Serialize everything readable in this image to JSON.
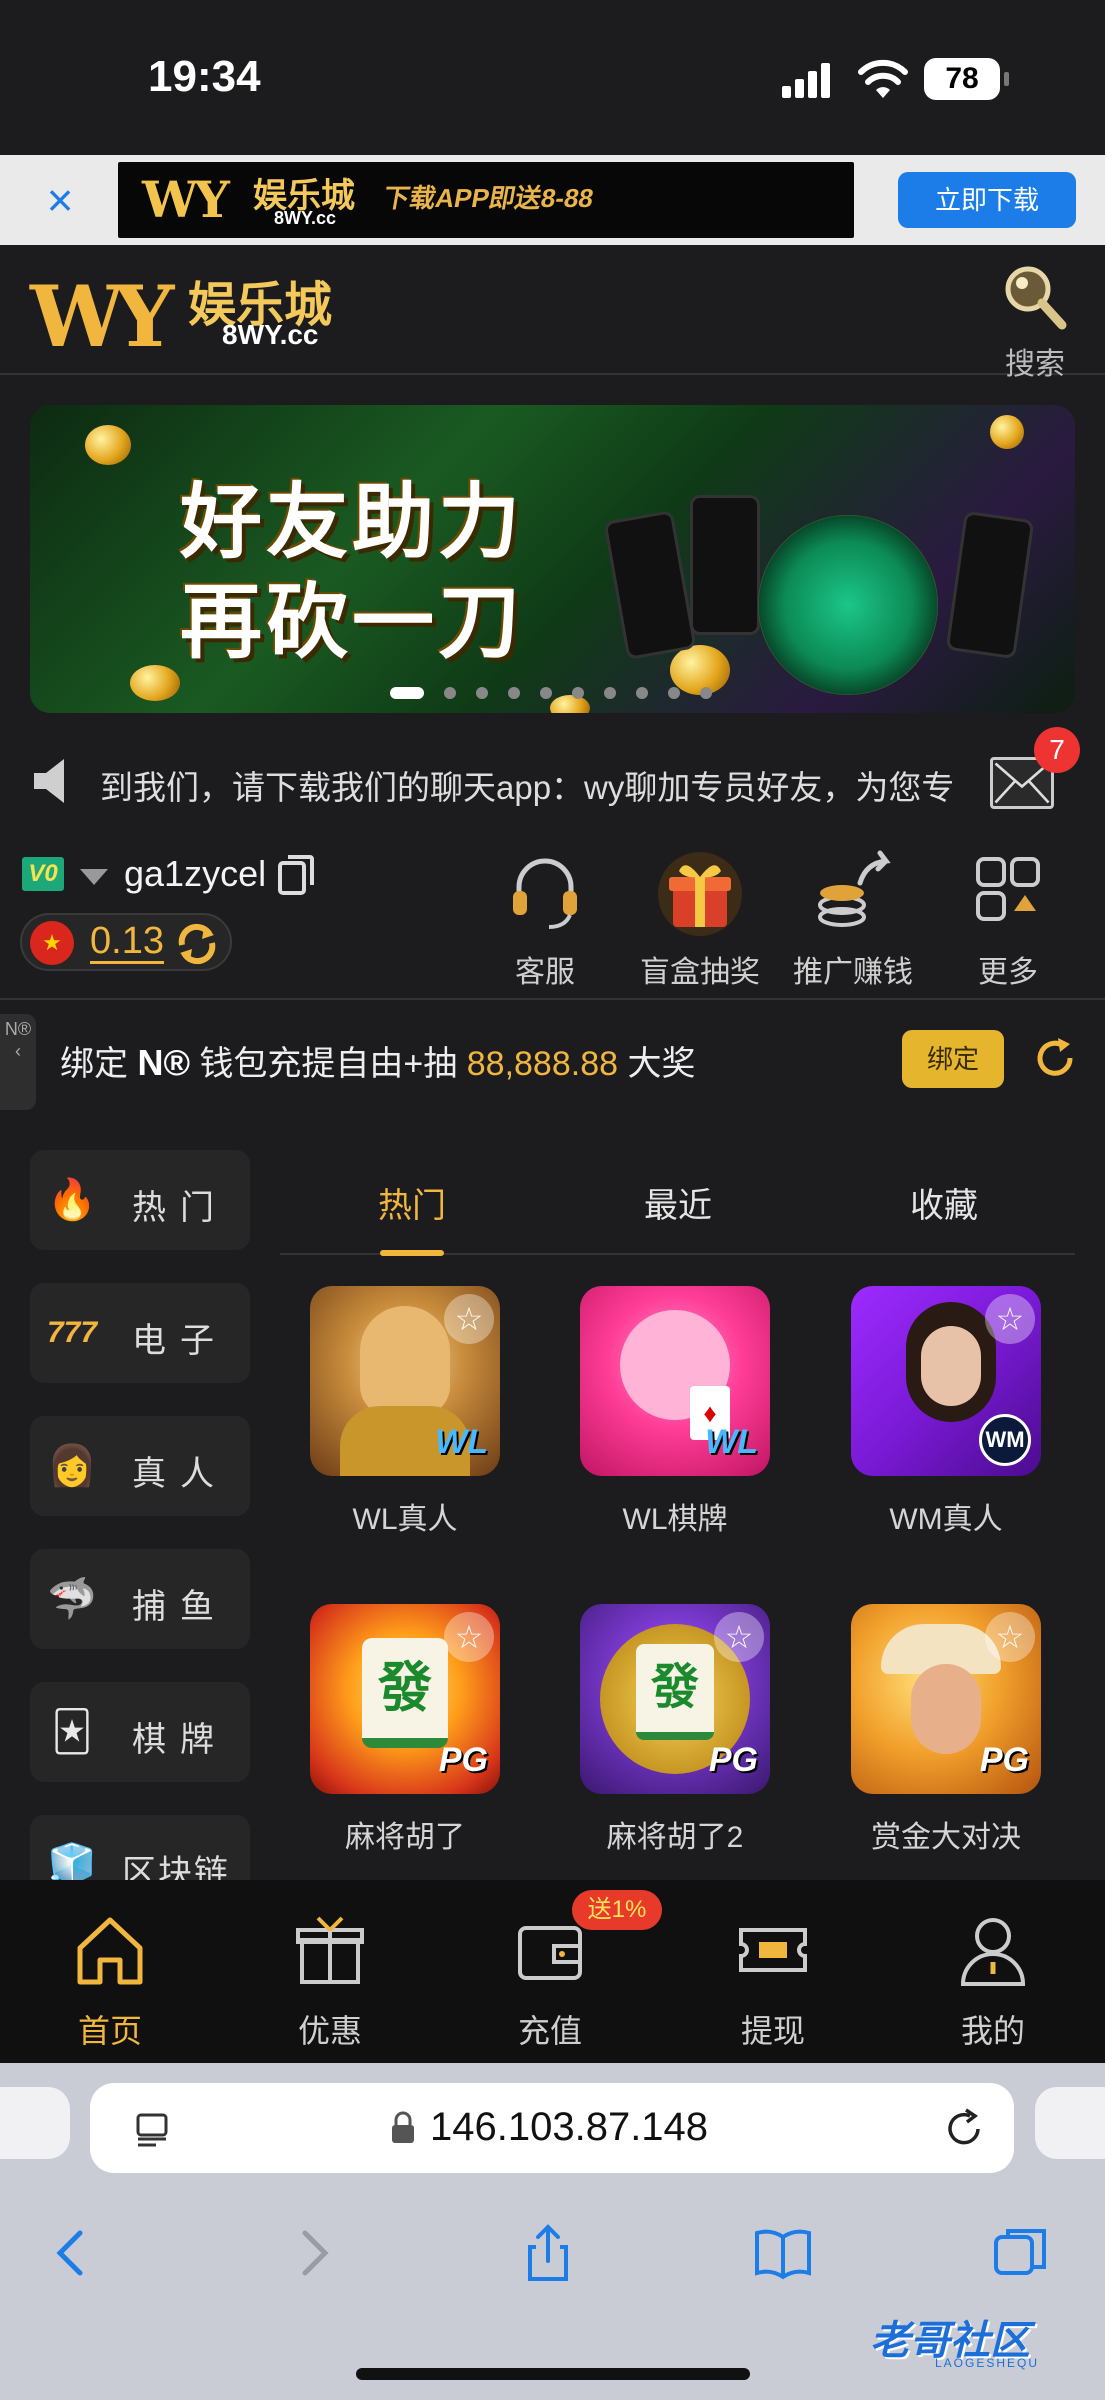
{
  "status_bar": {
    "time": "19:34",
    "battery": "78"
  },
  "download_bar": {
    "close_label": "×",
    "ad": {
      "brand_mark": "WY",
      "brand_name": "娱乐城",
      "domain": "8WY.cc",
      "promo_text": "下载APP即送8-88"
    },
    "download_button": "立即下载"
  },
  "header": {
    "brand_mark": "WY",
    "brand_name": "娱乐城",
    "domain": "8WY.cc",
    "search_label": "搜索",
    "search_icon": "search-icon"
  },
  "banner": {
    "line1": "好友助力",
    "line2": "再砍一刀",
    "slide_count": 10,
    "active_slide": 0
  },
  "marquee": {
    "text": "到我们，请下载我们的聊天app：wy聊加专员好友，为您专",
    "unread_count": "7"
  },
  "user": {
    "vip_level": "V0",
    "username": "ga1zycel",
    "balance": "0.13",
    "currency_flag": "★"
  },
  "quick_actions": [
    {
      "label": "客服",
      "icon": "headset-icon"
    },
    {
      "label": "盲盒抽奖",
      "icon": "gift-box-icon"
    },
    {
      "label": "推广赚钱",
      "icon": "coins-share-icon"
    },
    {
      "label": "更多",
      "icon": "grid-more-icon"
    }
  ],
  "bind_wallet": {
    "side_tab": "N®",
    "prefix": "绑定",
    "brand": "N®",
    "middle": "钱包充提自由+抽",
    "amount": "88,888.88",
    "suffix": "大奖",
    "button": "绑定"
  },
  "categories": [
    {
      "label": "热门",
      "icon": "🔥"
    },
    {
      "label": "电子",
      "icon": "777"
    },
    {
      "label": "真人",
      "icon": "👩"
    },
    {
      "label": "捕鱼",
      "icon": "🦈"
    },
    {
      "label": "棋牌",
      "icon": "🃏"
    },
    {
      "label": "区块链",
      "icon": "🧊"
    }
  ],
  "tabs": [
    {
      "label": "热门",
      "active": true
    },
    {
      "label": "最近",
      "active": false
    },
    {
      "label": "收藏",
      "active": false
    }
  ],
  "games": [
    {
      "label": "WL真人",
      "logo": "WL"
    },
    {
      "label": "WL棋牌",
      "logo": "WL"
    },
    {
      "label": "WM真人",
      "logo": "WM"
    },
    {
      "label": "麻将胡了",
      "logo": "PG",
      "tile": "發"
    },
    {
      "label": "麻将胡了2",
      "logo": "PG",
      "tile": "發"
    },
    {
      "label": "赏金大对决",
      "logo": "PG"
    }
  ],
  "bottom_nav": [
    {
      "label": "首页",
      "active": true
    },
    {
      "label": "优惠",
      "active": false
    },
    {
      "label": "充值",
      "active": false
    },
    {
      "label": "提现",
      "active": false
    },
    {
      "label": "我的",
      "active": false
    }
  ],
  "recharge_promo": "送1%",
  "browser": {
    "address": "146.103.87.148",
    "watermark": "老哥社区",
    "watermark_sub": "LAOGESHEQU"
  },
  "colors": {
    "accent": "#f0b63e",
    "background": "#1c1c1e",
    "ios_blue": "#1d7de8",
    "badge_red": "#e33333"
  }
}
